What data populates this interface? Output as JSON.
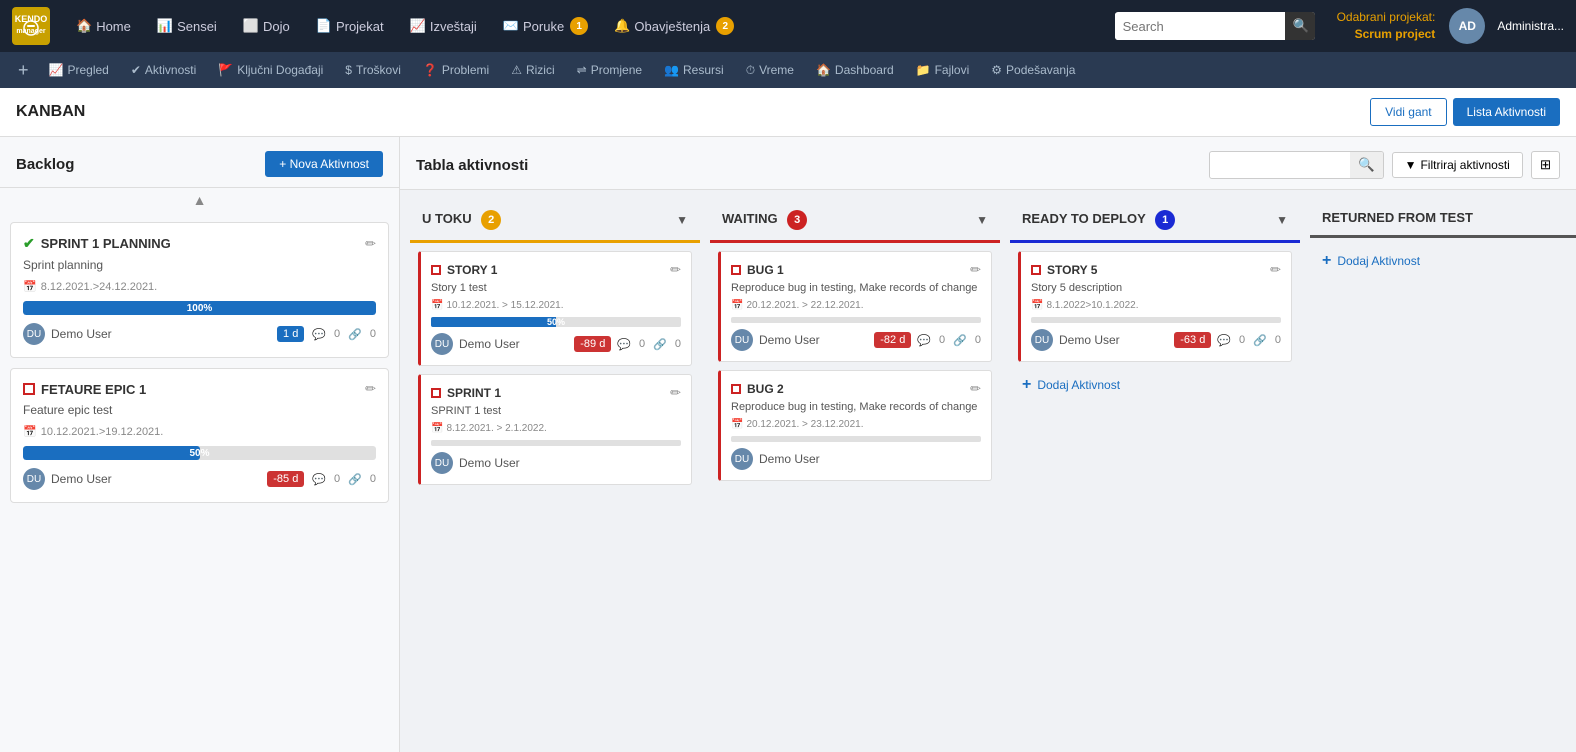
{
  "topNav": {
    "logo": "KENDO\nmanager",
    "items": [
      {
        "label": "Home",
        "icon": "🏠"
      },
      {
        "label": "Sensei",
        "icon": "📊"
      },
      {
        "label": "Dojo",
        "icon": "⬜"
      },
      {
        "label": "Projekat",
        "icon": "📄"
      },
      {
        "label": "Izveštaji",
        "icon": "📈"
      },
      {
        "label": "Poruke",
        "icon": "✉️",
        "badge": "1"
      },
      {
        "label": "Obavještenja",
        "icon": "🔔",
        "badge": "2"
      }
    ],
    "search_placeholder": "Search",
    "project_label": "Odabrani projekat:",
    "project_name": "Scrum project",
    "admin_label": "Administra..."
  },
  "secondNav": {
    "items": [
      {
        "label": "Pregled",
        "icon": "📈"
      },
      {
        "label": "Aktivnosti",
        "icon": "✔"
      },
      {
        "label": "Ključni Događaji",
        "icon": "🚩"
      },
      {
        "label": "Troškovi",
        "icon": "$"
      },
      {
        "label": "Problemi",
        "icon": "?"
      },
      {
        "label": "Rizici",
        "icon": "⚠"
      },
      {
        "label": "Promjene",
        "icon": "⇌"
      },
      {
        "label": "Resursi",
        "icon": "👥"
      },
      {
        "label": "Vreme",
        "icon": "⏱"
      },
      {
        "label": "Dashboard",
        "icon": "🏠"
      },
      {
        "label": "Fajlovi",
        "icon": "📁"
      },
      {
        "label": "Podešavanja",
        "icon": "⚙"
      }
    ]
  },
  "pageTitle": "KANBAN",
  "titleButtons": {
    "vidi_gant": "Vidi gant",
    "lista_aktivnosti": "Lista Aktivnosti"
  },
  "backlog": {
    "title": "Backlog",
    "nova_btn": "+ Nova Aktivnost",
    "cards": [
      {
        "id": "sprint1planning",
        "type": "check",
        "title": "SPRINT 1 PLANNING",
        "desc": "Sprint planning",
        "dates": "8.12.2021.>24.12.2021.",
        "progress": 100,
        "progress_label": "100%",
        "user": "Demo User",
        "day_badge": "1 d",
        "day_badge_type": "blue",
        "comments": "0",
        "links": "0"
      },
      {
        "id": "featureepic1",
        "type": "square",
        "title": "FETAURE EPIC 1",
        "desc": "Feature epic test",
        "dates": "10.12.2021.>19.12.2021.",
        "progress": 50,
        "progress_label": "50%",
        "user": "Demo User",
        "day_badge": "-85 d",
        "day_badge_type": "red",
        "comments": "0",
        "links": "0"
      }
    ]
  },
  "board": {
    "title": "Tabla aktivnosti",
    "search_placeholder": "",
    "filter_btn": "Filtriraj aktivnosti",
    "columns": [
      {
        "id": "u_toku",
        "label": "U TOKU",
        "badge": "2",
        "badge_color": "orange",
        "border_color": "#e8a000",
        "cards": [
          {
            "type": "square",
            "title": "STORY 1",
            "desc": "Story 1 test",
            "dates": "10.12.2021. > 15.12.2021.",
            "progress": 50,
            "progress_label": "50%",
            "user": "Demo User",
            "day_badge": "-89 d",
            "day_badge_type": "red",
            "comments": "0",
            "links": "0"
          },
          {
            "type": "square",
            "title": "SPRINT 1",
            "desc": "SPRINT 1 test",
            "dates": "8.12.2021. > 2.1.2022.",
            "progress": 0,
            "progress_label": "",
            "user": "Demo User",
            "day_badge": "",
            "day_badge_type": "",
            "comments": "",
            "links": ""
          }
        ]
      },
      {
        "id": "waiting",
        "label": "WAITING",
        "badge": "3",
        "badge_color": "red",
        "border_color": "#cc2222",
        "cards": [
          {
            "type": "square",
            "title": "BUG 1",
            "desc": "Reproduce bug in testing, Make records of change",
            "dates": "20.12.2021. > 22.12.2021.",
            "progress": 0,
            "progress_label": "",
            "user": "Demo User",
            "day_badge": "-82 d",
            "day_badge_type": "red",
            "comments": "0",
            "links": "0"
          },
          {
            "type": "square",
            "title": "BUG 2",
            "desc": "Reproduce bug in testing, Make records of change",
            "dates": "20.12.2021. > 23.12.2021.",
            "progress": 0,
            "progress_label": "",
            "user": "Demo User",
            "day_badge": "",
            "day_badge_type": "",
            "comments": "",
            "links": ""
          }
        ]
      },
      {
        "id": "ready_to_deploy",
        "label": "READY TO DEPLOY",
        "badge": "1",
        "badge_color": "blue",
        "border_color": "#1a2ad4",
        "cards": [
          {
            "type": "square",
            "title": "STORY 5",
            "desc": "Story 5 description",
            "dates": "8.1.2022>10.1.2022.",
            "progress": 0,
            "progress_label": "",
            "user": "Demo User",
            "day_badge": "-63 d",
            "day_badge_type": "red",
            "comments": "0",
            "links": "0"
          }
        ],
        "add_activity": "Dodaj Aktivnost"
      },
      {
        "id": "returned_from_test",
        "label": "RETURNED FROM TEST",
        "badge": "",
        "badge_color": "",
        "border_color": "#555",
        "cards": [],
        "add_activity": "Dodaj Aktivnost"
      }
    ]
  }
}
